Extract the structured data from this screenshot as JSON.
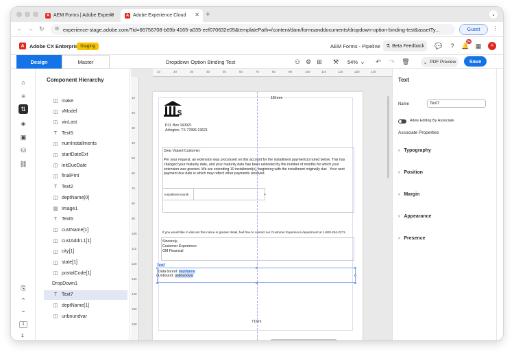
{
  "browser": {
    "tabs": [
      {
        "label": "AEM Forms | Adobe Experie",
        "active": false
      },
      {
        "label": "Adobe Experience Cloud",
        "active": true
      }
    ],
    "url": "experience-stage.adobe.com/?id=66756708-b69b-4165-a035-eef070632e05&templatePath=/content/dam/formsanddocuments/dropdown-option-binding-test&assetTy...",
    "guest_label": "Guest"
  },
  "app_header": {
    "brand": "Adobe CX Enterprise",
    "env_badge": "Staging",
    "center_title": "AEM Forms - Pipeline",
    "beta_feedback": "Beta Feedback",
    "notification_count": "9+"
  },
  "toolbar": {
    "design_tab": "Design",
    "master_tab": "Master",
    "document_title": "Dropdown Option Binding Test",
    "zoom": "54%",
    "pdf_preview": "PDF Preview",
    "save_label": "Save"
  },
  "component_panel": {
    "title": "Component Hierarchy",
    "items": [
      {
        "label": "make",
        "icon": "field-icon"
      },
      {
        "label": "vModel",
        "icon": "field-icon"
      },
      {
        "label": "vinLast",
        "icon": "field-icon"
      },
      {
        "label": "Text5",
        "icon": "text-icon"
      },
      {
        "label": "numInstallments",
        "icon": "field-icon"
      },
      {
        "label": "startDateExt",
        "icon": "field-icon"
      },
      {
        "label": "initDueDate",
        "icon": "field-icon"
      },
      {
        "label": "finalPmt",
        "icon": "field-icon"
      },
      {
        "label": "Text2",
        "icon": "text-icon"
      },
      {
        "label": "deptName[0]",
        "icon": "field-icon"
      },
      {
        "label": "Image1",
        "icon": "image-icon"
      },
      {
        "label": "Text6",
        "icon": "text-icon"
      },
      {
        "label": "custName[1]",
        "icon": "field-icon"
      },
      {
        "label": "custAddrL1[1]",
        "icon": "field-icon"
      },
      {
        "label": "city[1]",
        "icon": "field-icon"
      },
      {
        "label": "state[1]",
        "icon": "field-icon"
      },
      {
        "label": "postalCode[1]",
        "icon": "field-icon"
      },
      {
        "label": "DropDown1",
        "icon": ""
      },
      {
        "label": "Text7",
        "icon": "text-icon"
      },
      {
        "label": "deptName[1]",
        "icon": "field-icon"
      },
      {
        "label": "unboundvar",
        "icon": "field-icon"
      }
    ],
    "page_number": "1"
  },
  "canvas": {
    "ruler_top": [
      "10",
      "20",
      "30",
      "40",
      "50",
      "60",
      "70",
      "80",
      "90",
      "100",
      "110",
      "120",
      "130",
      "140"
    ],
    "ruler_left": [
      "10",
      "20",
      "30",
      "40",
      "50",
      "60",
      "70",
      "80",
      "90",
      "100",
      "110",
      "120",
      "130",
      "140",
      "150",
      "160"
    ],
    "dim_top": "181mm",
    "dim_bottom": "71mm",
    "address_line1": "P.O. Box 160921",
    "address_line2": "Arlington, TX 77896-13621",
    "salutation": "Dear Valued Customer,",
    "paragraph": "Per your request, an extension was processed on this account for the installment payment(s) noted below. This has changed your maturity date, and your maturity date has been extended by the number of months for which your extension was granted. We are extending 10 installment(s), beginning with the installment originally due . Your next payment due date is  which may reflect other payments received.",
    "installment_label": "Installment month",
    "contact": "If you would like to discuss this notice in greater detail, feel free to contact our Customer Experience department at 1-800-284-2271.",
    "closing1": "Sincerely,",
    "closing2": "Customer Experience",
    "closing3": "GM Financial",
    "text7_label": "Text7",
    "data_bound_label": "Data bound:",
    "data_bound_value": "deptName",
    "unbound_label": "Unbound:",
    "unbound_value": "unboundvar"
  },
  "properties": {
    "title": "Text",
    "name_label": "Name",
    "name_value": "Text7",
    "allow_editing": "Allow Editing By Associate",
    "associate_properties": "Associate Properties",
    "sections": [
      "Typography",
      "Position",
      "Margin",
      "Appearance",
      "Presence"
    ]
  }
}
